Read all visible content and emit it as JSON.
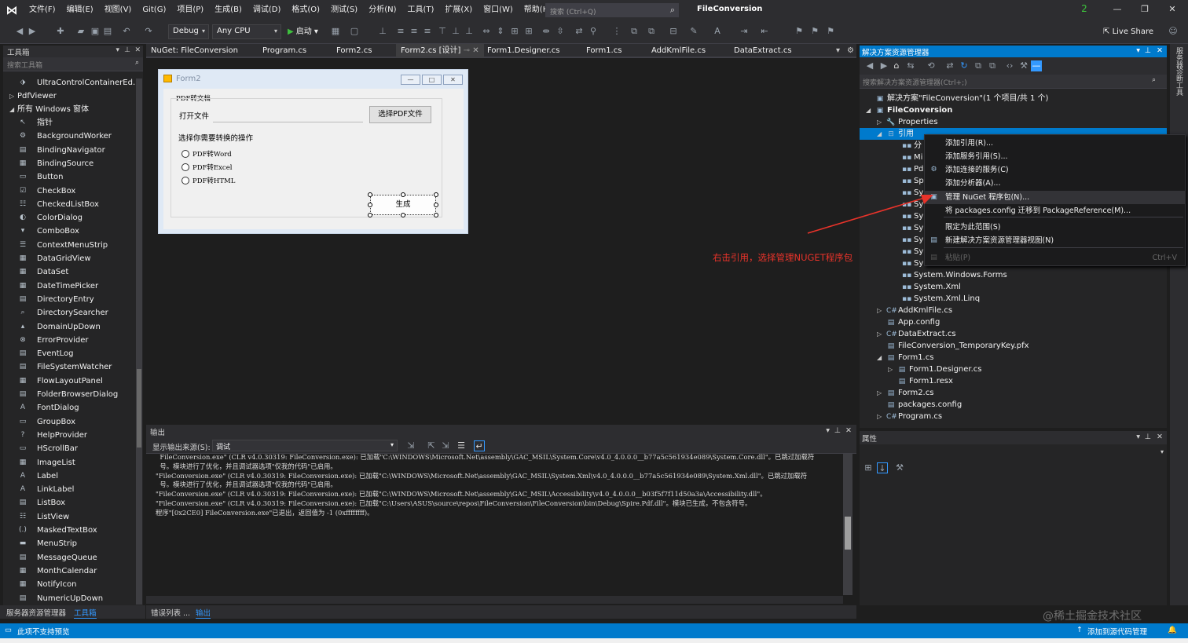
{
  "menubar": {
    "items": [
      "文件(F)",
      "编辑(E)",
      "视图(V)",
      "Git(G)",
      "项目(P)",
      "生成(B)",
      "调试(D)",
      "格式(O)",
      "测试(S)",
      "分析(N)",
      "工具(T)",
      "扩展(X)",
      "窗口(W)",
      "帮助(H)"
    ],
    "search_placeholder": "搜索 (Ctrl+Q)",
    "solution_name": "FileConversion",
    "notification_count": "2"
  },
  "toolbar": {
    "config": "Debug",
    "platform": "Any CPU",
    "start_label": "启动",
    "live_share": "Live Share"
  },
  "toolbox": {
    "title": "工具箱",
    "search_placeholder": "搜索工具箱",
    "top_items": [
      "UltraControlContainerEd...",
      "PdfViewer"
    ],
    "group": "所有 Windows 窗体",
    "items": [
      "指针",
      "BackgroundWorker",
      "BindingNavigator",
      "BindingSource",
      "Button",
      "CheckBox",
      "CheckedListBox",
      "ColorDialog",
      "ComboBox",
      "ContextMenuStrip",
      "DataGridView",
      "DataSet",
      "DateTimePicker",
      "DirectoryEntry",
      "DirectorySearcher",
      "DomainUpDown",
      "ErrorProvider",
      "EventLog",
      "FileSystemWatcher",
      "FlowLayoutPanel",
      "FolderBrowserDialog",
      "FontDialog",
      "GroupBox",
      "HelpProvider",
      "HScrollBar",
      "ImageList",
      "Label",
      "LinkLabel",
      "ListBox",
      "ListView",
      "MaskedTextBox",
      "MenuStrip",
      "MessageQueue",
      "MonthCalendar",
      "NotifyIcon",
      "NumericUpDown"
    ],
    "bottom_tabs": [
      "服务器资源管理器",
      "工具箱"
    ]
  },
  "doc_tabs": [
    "NuGet: FileConversion",
    "Program.cs",
    "Form2.cs",
    "Form2.cs [设计]",
    "Form1.Designer.cs",
    "Form1.cs",
    "AddKmlFile.cs",
    "DataExtract.cs"
  ],
  "form": {
    "title": "Form2",
    "group_label": "PDF转文档",
    "open_file_label": "打开文件",
    "select_button": "选择PDF文件",
    "op_label": "选择你需要转换的操作",
    "radios": [
      "PDF转Word",
      "PDF转Excel",
      "PDF转HTML"
    ],
    "generate_button": "生成"
  },
  "output": {
    "title": "输出",
    "source_label": "显示输出来源(S):",
    "source_value": "调试",
    "lines": [
      "  FileConversion.exe\" (CLR v4.0.30319: FileConversion.exe): 已加载\"C:\\WINDOWS\\Microsoft.Net\\assembly\\GAC_MSIL\\System.Core\\v4.0_4.0.0.0__b77a5c561934e089\\System.Core.dll\"。已跳过加载符",
      "  号。模块进行了优化，并且调试器选项\"仅我的代码\"已启用。",
      "\"FileConversion.exe\" (CLR v4.0.30319: FileConversion.exe): 已加载\"C:\\WINDOWS\\Microsoft.Net\\assembly\\GAC_MSIL\\System.Xml\\v4.0_4.0.0.0__b77a5c561934e089\\System.Xml.dll\"。已跳过加载符",
      "  号。模块进行了优化，并且调试器选项\"仅我的代码\"已启用。",
      "\"FileConversion.exe\" (CLR v4.0.30319: FileConversion.exe): 已加载\"C:\\WINDOWS\\Microsoft.Net\\assembly\\GAC_MSIL\\Accessibility\\v4.0_4.0.0.0__b03f5f7f11d50a3a\\Accessibility.dll\"。",
      "\"FileConversion.exe\" (CLR v4.0.30319: FileConversion.exe): 已加载\"C:\\Users\\ASUS\\source\\repos\\FileConversion\\FileConversion\\bin\\Debug\\Spire.Pdf.dll\"。模块已生成，不包含符号。",
      "程序\"[0x2CE0] FileConversion.exe\"已退出，返回值为 -1 (0xffffffff)。"
    ],
    "bottom_tabs": [
      "错误列表 ...",
      "输出"
    ]
  },
  "solution_explorer": {
    "title": "解决方案资源管理器",
    "search_placeholder": "搜索解决方案资源管理器(Ctrl+;)",
    "solution_line": "解决方案\"FileConversion\"(1 个项目/共 1 个)",
    "project": "FileConversion",
    "properties": "Properties",
    "references": "引用",
    "ref_children": [
      "分",
      "Mi",
      "Pd",
      "Sp",
      "Sy",
      "Sy",
      "Sy",
      "Sy",
      "Sy",
      "Sy",
      "Sy"
    ],
    "ref_full": [
      "System.Windows.Forms",
      "System.Xml",
      "System.Xml.Linq"
    ],
    "files": [
      "AddKmlFile.cs",
      "App.config",
      "DataExtract.cs",
      "FileConversion_TemporaryKey.pfx",
      "Form1.cs",
      "Form1.Designer.cs",
      "Form1.resx",
      "Form2.cs",
      "packages.config",
      "Program.cs"
    ]
  },
  "properties_pane": {
    "title": "属性"
  },
  "context_menu": {
    "items": [
      "添加引用(R)...",
      "添加服务引用(S)...",
      "添加连接的服务(C)",
      "添加分析器(A)...",
      "管理 NuGet 程序包(N)...",
      "将 packages.config 迁移到 PackageReference(M)...",
      "限定为此范围(S)",
      "新建解决方案资源管理器视图(N)",
      "粘贴(P)"
    ],
    "paste_shortcut": "Ctrl+V"
  },
  "annotation": "右击引用，选择管理NUGET程序包",
  "right_strip": [
    "服务器",
    "诊断工具"
  ],
  "status": {
    "left": "此项不支持预览",
    "right": "添加到源代码管理"
  },
  "watermark": "@稀土掘金技术社区"
}
